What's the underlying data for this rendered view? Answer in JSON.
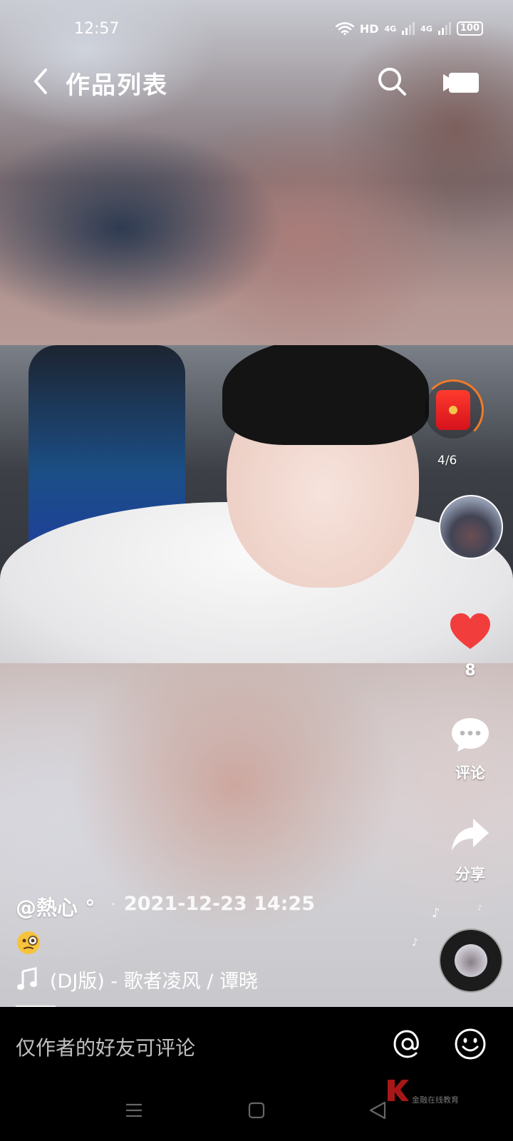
{
  "status_bar": {
    "time": "12:57",
    "hd_label": "HD",
    "net1": "4G",
    "net2": "4G",
    "battery": "100"
  },
  "header": {
    "title": "作品列表",
    "back_icon": "chevron-left-icon",
    "search_icon": "search-icon",
    "camera_icon": "video-camera-icon"
  },
  "side": {
    "redpacket_count": "4/6",
    "like_count": "8",
    "comment_label": "评论",
    "share_label": "分享",
    "accent_red": "#f23d3d",
    "ring_orange": "#f07a2a"
  },
  "caption": {
    "author": "@熱心 °",
    "separator": "·",
    "date": "2021-12-23 14:25",
    "emoji": "face-with-monocle",
    "song": "(DJ版) - 歌者凌风 / 谭晓"
  },
  "comment_bar": {
    "placeholder": "仅作者的好友可评论"
  },
  "watermark": {
    "text": "金融在线教育"
  }
}
